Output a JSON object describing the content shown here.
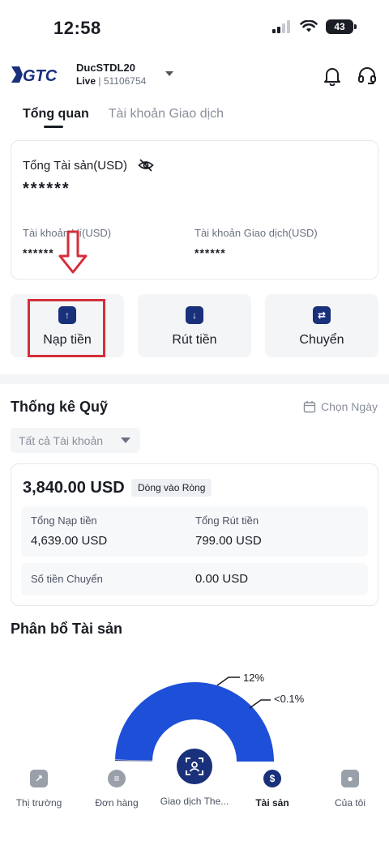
{
  "status_bar": {
    "time": "12:58",
    "battery": "43"
  },
  "header": {
    "logo_text": "GTC",
    "account_name": "DucSTDL20",
    "account_mode": "Live",
    "account_id": "51106754",
    "icons": [
      "bell-icon",
      "headset-icon"
    ]
  },
  "tabs": [
    {
      "label": "Tổng quan",
      "active": true
    },
    {
      "label": "Tài khoản Giao dịch",
      "active": false
    }
  ],
  "assets": {
    "title": "Tổng Tài sản(USD)",
    "total_masked": "******",
    "wallet_label": "Tài khoản Ví(USD)",
    "wallet_masked": "******",
    "trading_label": "Tài khoản Giao dịch(USD)",
    "trading_masked": "******"
  },
  "actions": [
    {
      "label": "Nạp tiền",
      "icon": "deposit-icon"
    },
    {
      "label": "Rút tiền",
      "icon": "withdraw-icon"
    },
    {
      "label": "Chuyển",
      "icon": "transfer-icon"
    }
  ],
  "fund_stats": {
    "title": "Thống kê Quỹ",
    "date_picker": "Chọn Ngày",
    "account_filter": "Tất cả Tài khoản",
    "net_amount": "3,840.00 USD",
    "net_badge": "Dòng vào Ròng",
    "total_deposit_label": "Tổng Nạp tiền",
    "total_deposit_value": "4,639.00 USD",
    "total_withdraw_label": "Tổng Rút tiền",
    "total_withdraw_value": "799.00 USD",
    "transfer_label": "Số tiền Chuyển",
    "transfer_value": "0.00 USD"
  },
  "distribution": {
    "title": "Phân bổ Tài sản",
    "labels": [
      "12%",
      "<0.1%"
    ]
  },
  "chart_data": {
    "type": "pie",
    "title": "Phân bổ Tài sản",
    "slices": [
      {
        "label": "",
        "value": 88
      },
      {
        "label": "12%",
        "value": 12
      },
      {
        "label": "<0.1%",
        "value": 0.1
      }
    ]
  },
  "bottom_nav": [
    {
      "label": "Thị trường",
      "icon": "market-icon",
      "active": false
    },
    {
      "label": "Đơn hàng",
      "icon": "orders-icon",
      "active": false
    },
    {
      "label": "Giao dịch The...",
      "icon": "copy-trade-icon",
      "active": false
    },
    {
      "label": "Tài sản",
      "icon": "assets-icon",
      "active": true
    },
    {
      "label": "Của tôi",
      "icon": "profile-icon",
      "active": false
    }
  ],
  "colors": {
    "brand": "#19307a",
    "chart_main": "#1d4fd8",
    "chart_secondary": "#3b6cf0",
    "highlight": "#d32f3a"
  }
}
